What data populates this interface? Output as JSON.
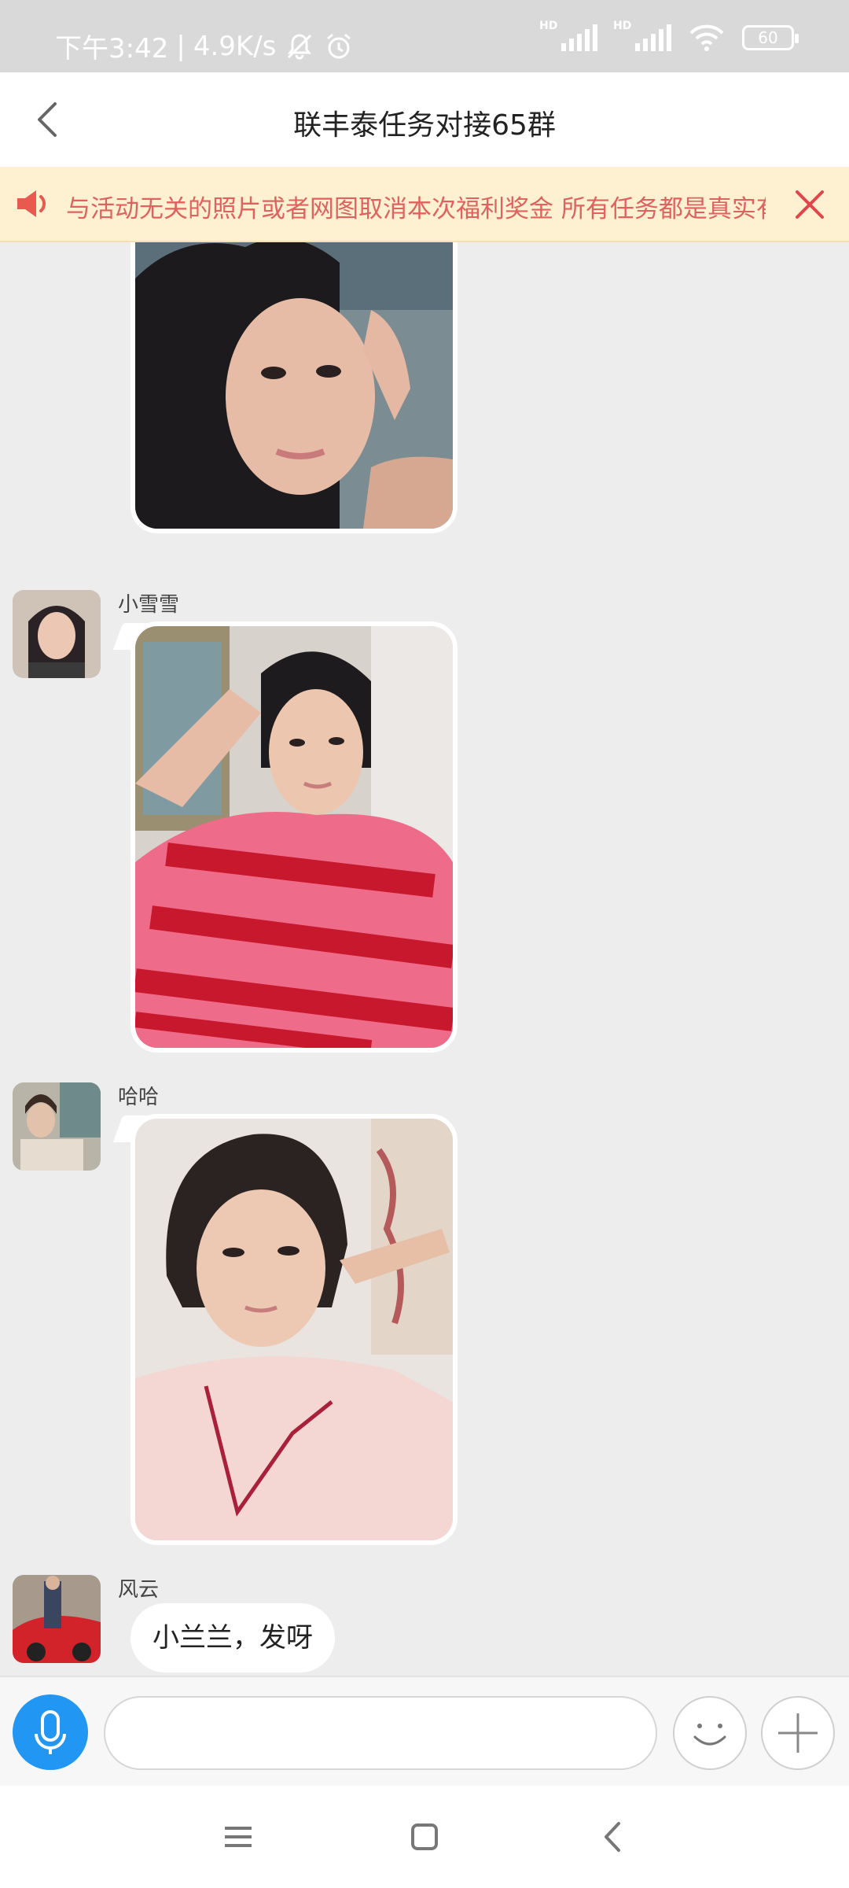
{
  "status_bar": {
    "time": "下午3:42",
    "separator": "|",
    "net_speed": "4.9K/s",
    "sim1_label": "HD",
    "sim2_label": "HD",
    "battery": "60",
    "icons": [
      "mute-bell-icon",
      "alarm-icon",
      "signal-icon",
      "signal-icon",
      "wifi-icon",
      "battery-icon"
    ]
  },
  "header": {
    "title": "联丰泰任务对接65群",
    "back_icon": "chevron-left-icon"
  },
  "notice": {
    "text": "与活动无关的照片或者网图取消本次福利奖金  所有任务都是真实有效",
    "speaker_icon": "speaker-icon",
    "close_icon": "close-icon",
    "accent_color": "#e0625e"
  },
  "messages": [
    {
      "type": "image",
      "sender": "",
      "image_desc": "selfie-salute"
    },
    {
      "type": "image",
      "sender": "小雪雪",
      "image_desc": "selfie-salute-pink-shirt"
    },
    {
      "type": "image",
      "sender": "哈哈",
      "image_desc": "selfie-salute-short-hair"
    },
    {
      "type": "text",
      "sender": "风云",
      "text": "小兰兰，发呀"
    }
  ],
  "input_bar": {
    "value": "",
    "placeholder": "",
    "mic_color": "#2196f3",
    "icons": [
      "microphone-icon",
      "emoji-icon",
      "plus-icon"
    ]
  },
  "nav_bar": {
    "icons": [
      "menu-icon",
      "home-icon",
      "back-icon"
    ]
  }
}
